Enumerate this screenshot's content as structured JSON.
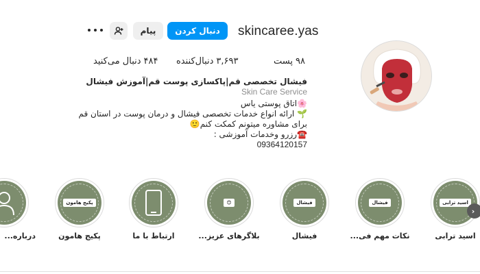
{
  "profile": {
    "username": "skincaree.yas",
    "follow_label": "دنبال کردن",
    "message_label": "پیام",
    "avatar_icon": "face-mask-avatar"
  },
  "stats": {
    "posts_value": "۹۸",
    "posts_label": "پست",
    "followers_value": "۳,۶۹۳",
    "followers_label": "دنبال‌کننده",
    "following_value": "۴۸۴",
    "following_label": "دنبال می‌کنید"
  },
  "bio": {
    "title": "فیشال تخصصی قم|پاکسازی پوست قم|آموزش فیشال",
    "category": "Skin Care Service",
    "line1": "🌸اتاق پوستی یاس",
    "line2": "🌱 ارائه انواع خدمات تخصصی فیشال و درمان پوست در استان قم",
    "line3": "برای مشاوره میتونم کمکت کنم🙂",
    "line4": "☎️رزرو وخدمات آموزشی :",
    "phone": "09364120157"
  },
  "highlights": [
    {
      "label": "اسید ترابی",
      "tag": "اسید ترابی"
    },
    {
      "label": "نکات مهم فی...",
      "tag": "فیشال"
    },
    {
      "label": "فیشال",
      "tag": "فیشال"
    },
    {
      "label": "بلاگرهای عزیز...",
      "tag": ""
    },
    {
      "label": "ارتباط با ما",
      "tag": ""
    },
    {
      "label": "پکیج هامون",
      "tag": "پکیج هامون"
    },
    {
      "label": "درباره...",
      "tag": ""
    }
  ],
  "colors": {
    "follow_button": "#0095f6",
    "highlight_bg": "#7d8d6e"
  }
}
